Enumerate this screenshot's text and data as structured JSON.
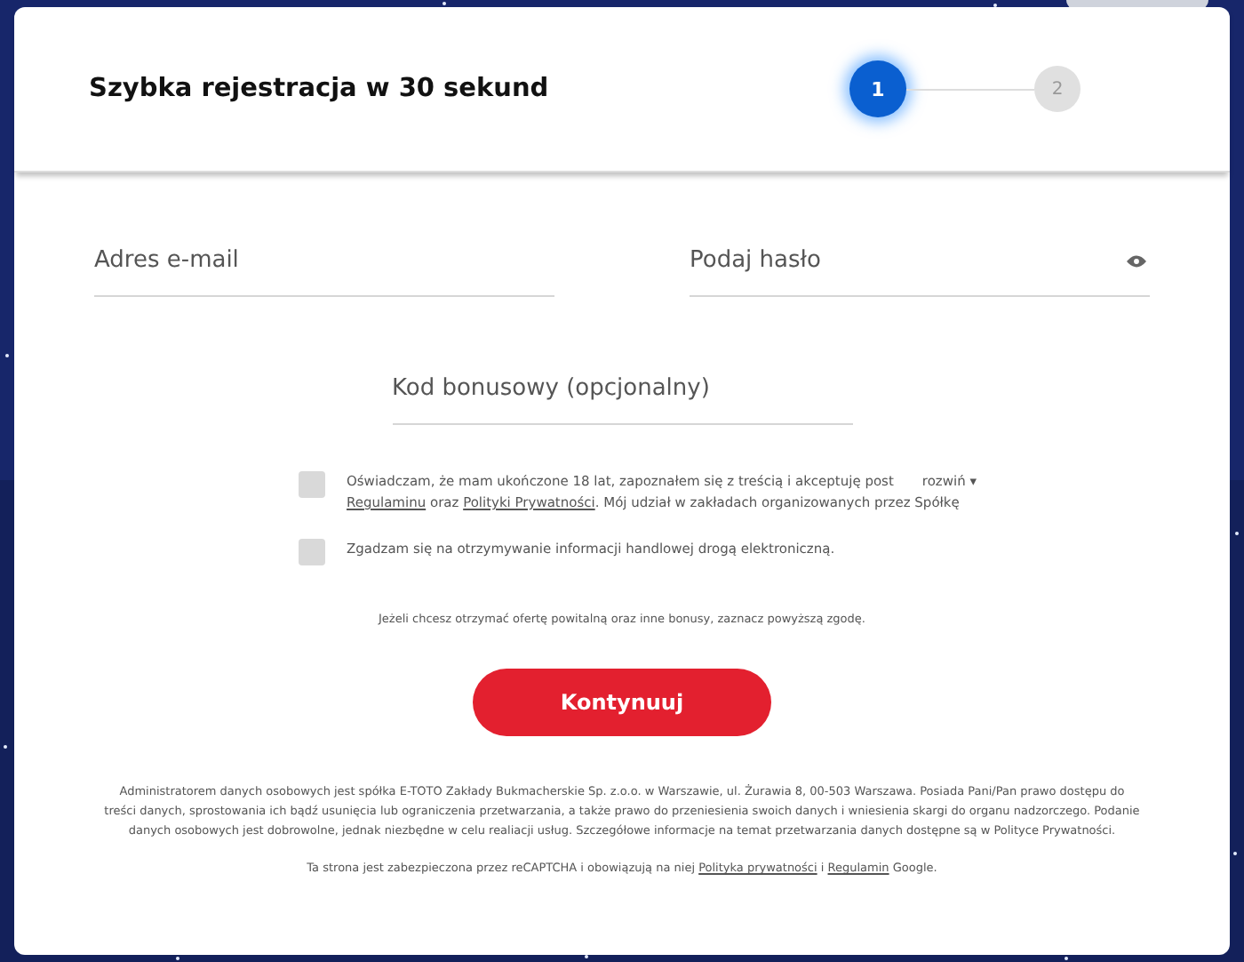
{
  "header": {
    "title": "Szybka rejestracja w 30 sekund"
  },
  "steps": [
    {
      "label": "1",
      "selected": true
    },
    {
      "label": "2",
      "selected": false
    }
  ],
  "fields": {
    "email": {
      "placeholder": "Adres e-mail"
    },
    "password": {
      "placeholder": "Podaj hasło"
    },
    "bonus": {
      "placeholder": "Kod bonusowy (opcjonalny)"
    }
  },
  "consents": [
    {
      "checked": false,
      "lines": [
        [
          {
            "text": "Oświadczam, że mam ukończone 18 lat, zapoznałem się z treścią i akceptuję post",
            "link": false
          }
        ],
        [
          {
            "text": "Regulaminu",
            "link": true
          },
          {
            "text": " oraz ",
            "link": false
          },
          {
            "text": "Polityki Prywatności",
            "link": true
          },
          {
            "text": ". Mój udział w zakładach organizowanych przez Spółkę",
            "link": false
          }
        ]
      ],
      "expand": "rozwiń ▾"
    },
    {
      "checked": false,
      "lines": [
        [
          {
            "text": "Zgadzam się na otrzymywanie informacji handlowej drogą elektroniczną.",
            "link": false
          }
        ]
      ]
    }
  ],
  "hint": "Jeżeli chcesz otrzymać ofertę powitalną oraz inne bonusy, zaznacz powyższą zgodę.",
  "submit": "Kontynuuj",
  "legal": "Administratorem danych osobowych jest spółka E-TOTO Zakłady Bukmacherskie Sp. z.o.o. w Warszawie, ul. Żurawia 8, 00-503 Warszawa. Posiada Pani/Pan prawo dostępu do treści danych, sprostowania ich bądź usunięcia lub ograniczenia przetwarzania, a także prawo do przeniesienia swoich danych i wniesienia skargi do organu nadzorczego. Podanie danych osobowych jest dobrowolne, jednak niezbędne w celu realiacji usług. Szczegółowe informacje na temat przetwarzania danych dostępne są w Polityce Prywatności.",
  "recaptcha": [
    {
      "text": "Ta strona jest zabezpieczona przez reCAPTCHA i obowiązują na niej ",
      "link": false
    },
    {
      "text": "Polityka prywatności",
      "link": true
    },
    {
      "text": " i ",
      "link": false
    },
    {
      "text": "Regulamin",
      "link": true
    },
    {
      "text": " Google.",
      "link": false
    }
  ]
}
